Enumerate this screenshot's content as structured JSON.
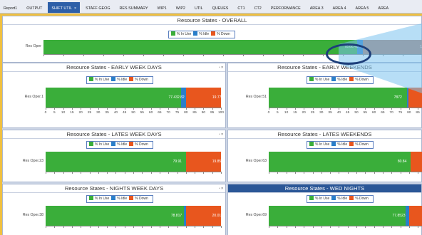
{
  "tabs": [
    {
      "label": "Report1"
    },
    {
      "label": "OUTPUT"
    },
    {
      "label": "SHIFT UTIL",
      "active": true,
      "close": "×"
    },
    {
      "label": "STAFF GEOG"
    },
    {
      "label": "RES SUMMARY"
    },
    {
      "label": "WIP1"
    },
    {
      "label": "WIP2"
    },
    {
      "label": "UTIL"
    },
    {
      "label": "QUEUES"
    },
    {
      "label": "CT1"
    },
    {
      "label": "CT2"
    },
    {
      "label": "PERFORMANCE"
    },
    {
      "label": "AREA 3"
    },
    {
      "label": "AREA 4"
    },
    {
      "label": "AREA 5"
    },
    {
      "label": "AREA"
    }
  ],
  "legend": {
    "in_use": "% In Use",
    "idle": "% Idle",
    "down": "% Down"
  },
  "colors": {
    "in_use": "#3aae3a",
    "idle": "#2a7ec9",
    "down": "#e8561e",
    "accent": "#2b5797"
  },
  "panel_controls": "▫ ×",
  "panels": [
    {
      "title": "Resource States - OVERALL",
      "res": "Res Oper",
      "in_use": 78.6,
      "idle": 1.48,
      "down": 19.0,
      "labels": [
        "78.6",
        "6.48",
        "",
        "19."
      ],
      "axis": false
    },
    {
      "title": "Resource States - EARLY WEEK DAYS",
      "res": "Res Oper.1",
      "in_use": 77.43,
      "idle": 2.82,
      "down": 19.77,
      "labels": [
        "77.43",
        "2.82",
        "19.77"
      ],
      "axis": true
    },
    {
      "title": "Resource States - EARLY WEEKENDS",
      "res": "Res Oper.51",
      "in_use": 78.72,
      "idle": 0.8,
      "down": 19.4,
      "labels": [
        "787",
        "2",
        "19."
      ],
      "axis": true
    },
    {
      "title": "Resource States - LATES WEEK DAYS",
      "res": "Res Oper.23",
      "in_use": 79.91,
      "idle": 0.2,
      "down": 19.85,
      "labels": [
        "79.",
        "91",
        "19.85"
      ],
      "axis": false
    },
    {
      "title": "Resource States - LATES WEEKENDS",
      "res": "Res Oper.63",
      "in_use": 80.84,
      "idle": 0.2,
      "down": 19.0,
      "labels": [
        "80.84",
        "",
        "19."
      ],
      "axis": false
    },
    {
      "title": "Resource States - NIGHTS WEEK  DAYS",
      "res": "Res Oper.38",
      "in_use": 78.8,
      "idle": 1.17,
      "down": 20.01,
      "labels": [
        "78.",
        "8",
        "17",
        "20.01"
      ],
      "axis": false
    },
    {
      "title": "Resource States - WED NIGHTS",
      "res": "Res Oper.69",
      "in_use": 77.85,
      "idle": 2.23,
      "down": 19.0,
      "labels": [
        "77.",
        "85",
        "23",
        "19."
      ],
      "axis": false
    }
  ],
  "axis_ticks": [
    "0",
    "5",
    "10",
    "15",
    "20",
    "25",
    "30",
    "35",
    "40",
    "45",
    "50",
    "55",
    "60",
    "65",
    "70",
    "75",
    "80",
    "85",
    "90",
    "95",
    "100"
  ]
}
